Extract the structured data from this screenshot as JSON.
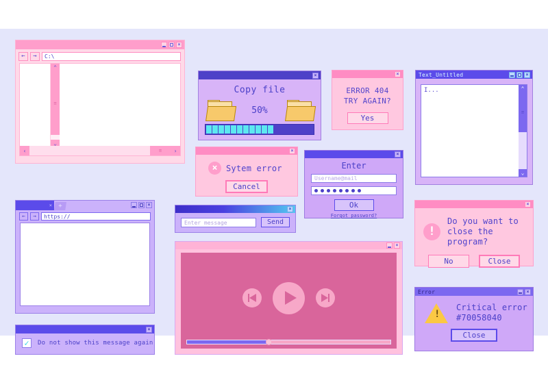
{
  "theme": {
    "canvas_bg": "#e4e6fb",
    "pink_accent": "#ff8cc3",
    "purple_accent": "#5b4bea",
    "cyan_accent": "#5ce8f0",
    "player_screen": "#d9659b"
  },
  "explorer": {
    "title": "",
    "back_icon": "←",
    "forward_icon": "→",
    "address_value": "C:\\",
    "scroll_up_icon": "⌃",
    "scroll_down_icon": "⌄",
    "scroll_left_icon": "‹",
    "scroll_right_icon": "›",
    "thumb_grip": "≡",
    "controls": {
      "minimize": "",
      "maximize": "",
      "close": "×"
    }
  },
  "copyfile": {
    "title": "",
    "heading": "Copy file",
    "percent_label": "50%",
    "progress_percent": 50,
    "progress_blocks_filled": 11,
    "progress_blocks_total": 19,
    "source_icon": "folder-icon",
    "dest_icon": "folder-icon",
    "controls": {
      "close": "×"
    }
  },
  "error404": {
    "title": "",
    "line1": "ERROR 404",
    "line2": "TRY AGAIN?",
    "confirm_label": "Yes",
    "controls": {
      "close": "×"
    }
  },
  "textwin": {
    "title": "Text_Untitled",
    "content": "I...",
    "scroll_up_icon": "⌃",
    "scroll_down_icon": "⌄",
    "thumb_grip": "≡",
    "controls": {
      "minimize": "",
      "maximize": "",
      "close": "×"
    }
  },
  "syserror": {
    "title": "",
    "icon": "error-circle-x-icon",
    "icon_glyph": "×",
    "message": "Sytem error",
    "cancel_label": "Cancel",
    "controls": {
      "close": "×"
    }
  },
  "enterwin": {
    "title": "",
    "heading": "Enter",
    "username_placeholder": "Username@mail",
    "password_dots": 8,
    "submit_label": "Ok",
    "forgot_label": "Forgot password?",
    "controls": {
      "close": "×"
    }
  },
  "browser": {
    "tab_close_icon": "×",
    "new_tab_label": "+",
    "back_icon": "←",
    "forward_icon": "→",
    "address_value": "https://",
    "controls": {
      "minimize": "",
      "maximize": "",
      "close": "×"
    }
  },
  "message_bar": {
    "title": "",
    "input_placeholder": "Enter message",
    "send_label": "Send",
    "controls": {
      "close": "×"
    }
  },
  "closeprog": {
    "title": "",
    "icon": "warning-circle-exclamation-icon",
    "icon_glyph": "!",
    "line1": "Do you want to",
    "line2": "close the program?",
    "no_label": "No",
    "close_label": "Close",
    "controls": {
      "close": "×"
    }
  },
  "criterror": {
    "title": "Error",
    "icon": "warning-triangle-icon",
    "line1": "Critical error",
    "line2": "#70058040",
    "close_label": "Close",
    "controls": {
      "minimize": "",
      "close": "×"
    }
  },
  "dns_bar": {
    "title": "",
    "checked": true,
    "check_glyph": "✓",
    "label": "Do not show this message again",
    "controls": {
      "close": "×"
    }
  },
  "player": {
    "title": "",
    "prev_icon": "skip-previous-icon",
    "play_icon": "play-icon",
    "next_icon": "skip-next-icon",
    "seek_percent": 40,
    "controls": {
      "minimize": "",
      "close": "×"
    }
  }
}
